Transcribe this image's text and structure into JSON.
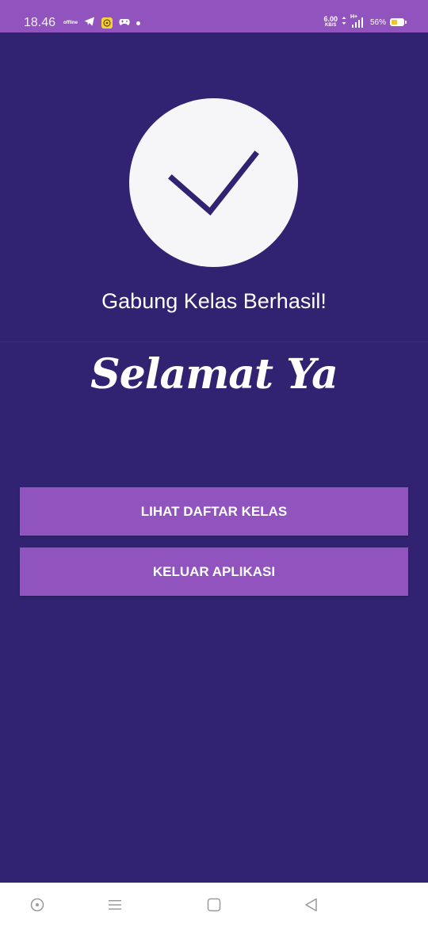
{
  "status_bar": {
    "time": "18.46",
    "offline_label": "offline",
    "net_speed_value": "6.00",
    "net_speed_unit": "KB/S",
    "network_type": "H+",
    "battery_percent": "56%",
    "battery_level": 0.56,
    "icons": [
      "telegram-icon",
      "notification-app-icon",
      "game-controller-icon",
      "dot-icon",
      "data-transfer-icon",
      "signal-icon",
      "battery-icon"
    ]
  },
  "main": {
    "success_icon": "checkmark-icon",
    "success_title": "Gabung Kelas Berhasil!",
    "greeting": "Selamat Ya"
  },
  "buttons": {
    "view_class_list": "LIHAT DAFTAR KELAS",
    "exit_app": "KELUAR APLIKASI"
  },
  "nav_bar": {
    "items": [
      "assistant-icon",
      "menu-icon",
      "home-icon",
      "back-icon"
    ]
  },
  "colors": {
    "background": "#312372",
    "accent": "#9153bd",
    "circle": "#f6f5f8",
    "check": "#312372"
  }
}
